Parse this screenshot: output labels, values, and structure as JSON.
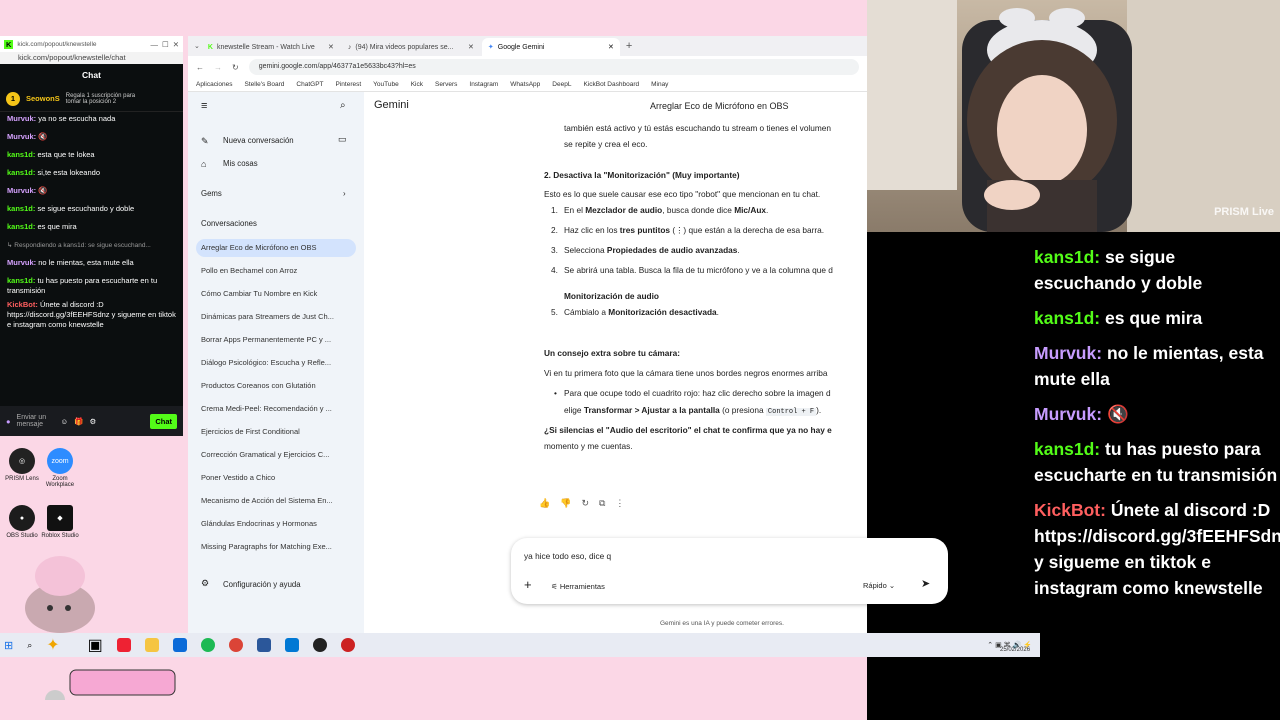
{
  "kick": {
    "window_url_short": "kick.com/popout/knewstelle",
    "url": "kick.com/popout/knewstelle/chat",
    "header": "Chat",
    "gift": {
      "user": "SeowonS",
      "count": "1",
      "text": "Regala 1 suscripción para tomar la posición 2"
    },
    "messages": [
      {
        "user": "Murvuk:",
        "text": "ya no se escucha nada",
        "color": "purple"
      },
      {
        "user": "Murvuk:",
        "text": "🔇",
        "color": "purple"
      },
      {
        "user": "kans1d:",
        "text": "esta que te lokea",
        "color": "green"
      },
      {
        "user": "kans1d:",
        "text": "si,te esta lokeando",
        "color": "green"
      },
      {
        "user": "Murvuk:",
        "text": "🔇",
        "color": "purple"
      },
      {
        "user": "kans1d:",
        "text": "se sigue escuchando y doble",
        "color": "green"
      },
      {
        "user": "kans1d:",
        "text": "es que mira",
        "color": "green"
      },
      {
        "user": "",
        "text": "↳ Respondiendo a kans1d: se sigue escuchand...",
        "color": "reply"
      },
      {
        "user": "Murvuk:",
        "text": "no le mientas, esta mute ella",
        "color": "purple"
      },
      {
        "user": "kans1d:",
        "text": "tu has puesto para escucharte en tu transmisión",
        "color": "green"
      },
      {
        "user": "KickBot:",
        "text": "Únete al discord :D https://discord.gg/3fEEHFSdnz y siguеme en tiktok e instagram como knewstelle",
        "color": "bot"
      }
    ],
    "input_placeholder": "Enviar un mensaje",
    "chat_button": "Chat"
  },
  "desktop_icons": [
    {
      "label": "PRISM Lens",
      "color": "#222"
    },
    {
      "label": "Zoom Workplace",
      "color": "#2d8cff"
    },
    {
      "label": "OBS Studio",
      "color": "#1c1c1c"
    },
    {
      "label": "Roblox Studio",
      "color": "#111"
    }
  ],
  "browser": {
    "tabs": [
      {
        "title": "knewstelle Stream - Watch Live",
        "active": false
      },
      {
        "title": "(94) Mira videos populares se...",
        "active": false
      },
      {
        "title": "Google Gemini",
        "active": true
      }
    ],
    "url": "gemini.google.com/app/46377a1e5633bc43?hl=es",
    "bookmarks": [
      "Aplicaciones",
      "Stelle's Board",
      "ChatGPT",
      "Pinterest",
      "YouTube",
      "Kick",
      "Servers",
      "Instagram",
      "WhatsApp",
      "DeepL",
      "KickBot Dashboard",
      "Minay"
    ]
  },
  "gemini": {
    "brand": "Gemini",
    "chat_title": "Arreglar Eco de Micrófono en OBS",
    "new_chat": "Nueva conversación",
    "my_stuff": "Mis cosas",
    "gems": "Gems",
    "conversations_header": "Conversaciones",
    "conversations": [
      "Arreglar Eco de Micrófono en OBS",
      "Pollo en Bechamel con Arroz",
      "Cómo Cambiar Tu Nombre en Kick",
      "Dinámicas para Streamers de Just Ch...",
      "Borrar Apps Permanentemente PC y ...",
      "Diálogo Psicológico: Escucha y Refle...",
      "Productos Coreanos con Glutatión",
      "Crema Medi-Peel: Recomendación y ...",
      "Ejercicios de First Conditional",
      "Corrección Gramatical y Ejercicios C...",
      "Poner Vestido a Chico",
      "Mecanismo de Acción del Sistema En...",
      "Glándulas Endocrinas y Hormonas",
      "Missing Paragraphs for Matching Exe..."
    ],
    "settings": "Configuración y ayuda",
    "response": {
      "intro_line1": "también está activo y tú estás escuchando tu stream o tienes el volumen",
      "intro_line2": "se repite y crea el eco.",
      "section2_title": "2. Desactiva la \"Monitorización\" (Muy importante)",
      "section2_intro": "Esto es lo que suele causar ese eco tipo \"robot\" que mencionan en tu chat.",
      "steps": [
        {
          "n": "1.",
          "pre": "En el ",
          "bold": "Mezclador de audio",
          "mid": ", busca donde dice ",
          "bold2": "Mic/Aux",
          "post": "."
        },
        {
          "n": "2.",
          "pre": "Haz clic en los ",
          "bold": "tres puntitos",
          "mid": " (⋮) que están a la derecha de esa barra.",
          "bold2": "",
          "post": ""
        },
        {
          "n": "3.",
          "pre": "Selecciona ",
          "bold": "Propiedades de audio avanzadas",
          "mid": ".",
          "bold2": "",
          "post": ""
        },
        {
          "n": "4.",
          "pre": "Se abrirá una tabla. Busca la fila de tu micrófono y ve a la columna que d",
          "bold": "",
          "mid": "",
          "bold2": "",
          "post": ""
        },
        {
          "n": "5.",
          "pre": "Cámbialo a ",
          "bold": "Monitorización desactivada",
          "mid": ".",
          "bold2": "",
          "post": ""
        }
      ],
      "step4_cont": "Monitorización de audio",
      "camera_title": "Un consejo extra sobre tu cámara:",
      "camera_intro": "Vi en tu primera foto que la cámara tiene unos bordes negros enormes arriba",
      "bullet_line1": "Para que ocupe todo el cuadrito rojo: haz clic derecho sobre la imagen d",
      "bullet_pre": "elige ",
      "bullet_bold": "Transformar > Ajustar a la pantalla",
      "bullet_mid": " (o presiona ",
      "bullet_code": "Control + F",
      "bullet_post": ").",
      "final_bold": "¿Si silencias el \"Audio del escritorio\" el chat te confirma que ya no hay e",
      "final_line2": "momento y me cuentas."
    },
    "prompt_text": "ya hice todo eso, dice q",
    "tools_label": "Herramientas",
    "mode_label": "Rápido",
    "disclaimer": "Gemini es una IA y puede cometer errores."
  },
  "taskbar": {
    "date": "25/02/2026"
  },
  "camera": {
    "watermark": "PRISM Live"
  },
  "overlay_chat": [
    {
      "user": "kans1d:",
      "text": "se sigue escuchando y doble",
      "color": "#53fc18",
      "cut": true
    },
    {
      "user": "kans1d:",
      "text": "es que mira",
      "color": "#53fc18"
    },
    {
      "user": "Murvuk:",
      "text": "no le mientas, esta mute ella",
      "color": "#c79cff"
    },
    {
      "user": "Murvuk:",
      "text": "🔇",
      "color": "#c79cff"
    },
    {
      "user": "kans1d:",
      "text": "tu has puesto para escucharte en tu transmisión",
      "color": "#53fc18"
    },
    {
      "user": "KickBot:",
      "text": "Únete al discord :D https://discord.gg/3fEEHFSdnz y sigueme en tiktok e instagram como knewstelle",
      "color": "#ff5f5f"
    }
  ]
}
